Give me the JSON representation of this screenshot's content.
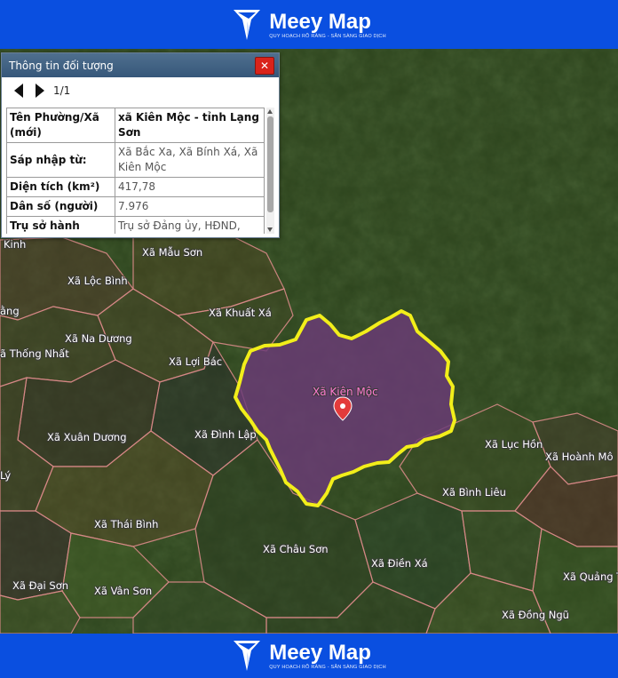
{
  "brand": {
    "name": "Meey Map",
    "tagline": "QUY HOẠCH RÕ RÀNG - SẴN SÀNG GIAO DỊCH"
  },
  "info_panel": {
    "title": "Thông tin đối tượng",
    "close_label": "✕",
    "page_indicator": "1/1",
    "rows": [
      {
        "key": "Tên Phường/Xã (mới)",
        "value": "xã Kiên Mộc - tỉnh Lạng Sơn",
        "bold_value": true
      },
      {
        "key": "Sáp nhập từ:",
        "value": "Xã Bắc Xa, Xã Bính Xá, Xã Kiên Mộc",
        "bold_value": false
      },
      {
        "key": "Diện tích (km²)",
        "value": "417,78",
        "bold_value": false
      },
      {
        "key": "Dân số (người)",
        "value": "7.976",
        "bold_value": false
      },
      {
        "key": "Trụ sở hành chính (mới)",
        "value": "Trụ sở Đảng ủy, HĐND, UBND xã Kiên Mộc",
        "bold_value": false
      }
    ]
  },
  "map": {
    "selected_commune": "Xã Kiên Mộc",
    "highlight_color": "#f2ee1a",
    "selected_fill": "#6b3a78",
    "marker_color": "#e33b3b",
    "commune_labels": [
      "Kinh",
      "Xã Mẫu Sơn",
      "Xã Lộc Bình",
      "ằng",
      "Xã Khuất Xá",
      "Xã Na Dương",
      "ã Thống Nhất",
      "Xã Lợi Bác",
      "Xã Xuân Dương",
      "Xã Đình Lập",
      "Xã Lục Hồn",
      "Xã Hoành Mô",
      "Lý",
      "Xã Bình Liêu",
      "Xã Thái Bình",
      "Xã Châu Sơn",
      "Xã Điền Xá",
      "Xã Đại Sơn",
      "Xã Vân Sơn",
      "Xã Quảng T",
      "Xã Đồng Ngũ"
    ]
  }
}
